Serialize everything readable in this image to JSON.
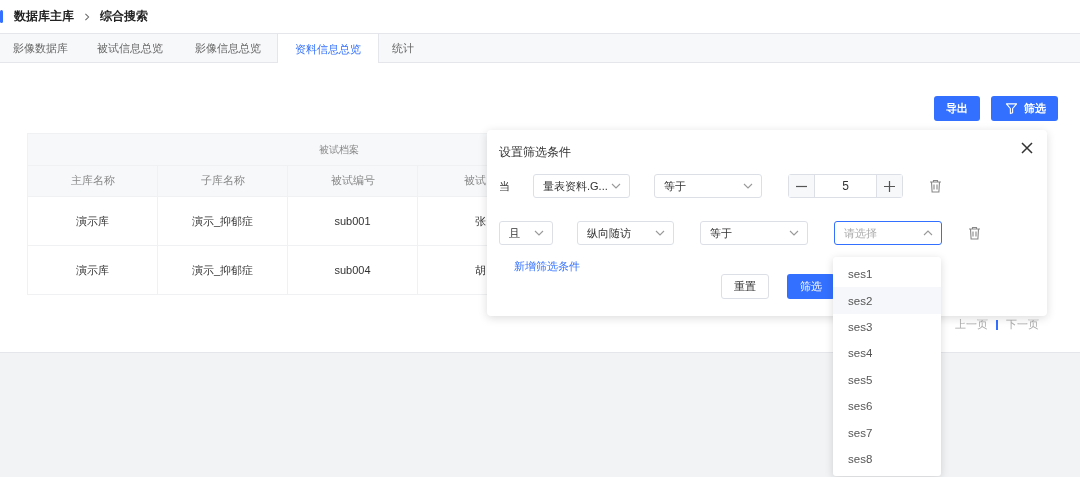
{
  "breadcrumb": [
    "数据库主库",
    "综合搜索"
  ],
  "tabs": [
    {
      "label": "影像数据库",
      "selected": false
    },
    {
      "label": "被试信息总览",
      "selected": false
    },
    {
      "label": "影像信息总览",
      "selected": false
    },
    {
      "label": "资料信息总览",
      "selected": true
    },
    {
      "label": "统计",
      "selected": false
    }
  ],
  "toolbar": {
    "export": "导出",
    "filter": "筛选"
  },
  "table": {
    "group_header": "被试档案",
    "columns": [
      "主库名称",
      "子库名称",
      "被试编号",
      "被试"
    ],
    "rows": [
      [
        "演示库",
        "演示_抑郁症",
        "sub001",
        "张"
      ],
      [
        "演示库",
        "演示_抑郁症",
        "sub004",
        "胡"
      ]
    ]
  },
  "pagination": {
    "prev": "上一页",
    "next": "下一页"
  },
  "filter_panel": {
    "title": "设置筛选条件",
    "conditions": [
      {
        "prefix": {
          "kind": "text",
          "label": "当"
        },
        "field": "量表资料.G...",
        "operator": "等于",
        "value": {
          "kind": "stepper",
          "value": "5"
        }
      },
      {
        "prefix": {
          "kind": "select",
          "label": "且"
        },
        "field": "纵向随访",
        "operator": "等于",
        "value": {
          "kind": "select",
          "placeholder": "请选择",
          "expanded": true
        }
      }
    ],
    "add_link": "新增筛选条件",
    "reset": "重置",
    "submit": "筛选"
  },
  "dropdown": [
    {
      "label": "ses1",
      "highlighted": false
    },
    {
      "label": "ses2",
      "highlighted": true
    },
    {
      "label": "ses3",
      "highlighted": false
    },
    {
      "label": "ses4",
      "highlighted": false
    },
    {
      "label": "ses5",
      "highlighted": false
    },
    {
      "label": "ses6",
      "highlighted": false
    },
    {
      "label": "ses7",
      "highlighted": false
    },
    {
      "label": "ses8",
      "highlighted": false
    }
  ]
}
